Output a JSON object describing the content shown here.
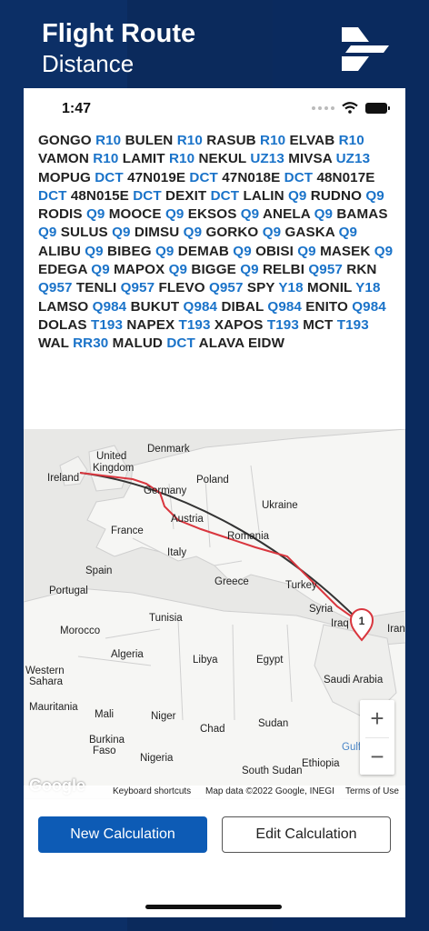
{
  "header": {
    "title_line1": "Flight Route",
    "title_line2": "Distance"
  },
  "status_bar": {
    "time": "1:47"
  },
  "route": [
    [
      "GONGO",
      "w"
    ],
    [
      "R10",
      "a"
    ],
    [
      "BULEN",
      "w"
    ],
    [
      "R10",
      "a"
    ],
    [
      "RASUB",
      "w"
    ],
    [
      "R10",
      "a"
    ],
    [
      "ELVAB",
      "w"
    ],
    [
      "R10",
      "a"
    ],
    [
      "VAMON",
      "w"
    ],
    [
      "R10",
      "a"
    ],
    [
      "LAMIT",
      "w"
    ],
    [
      "R10",
      "a"
    ],
    [
      "NEKUL",
      "w"
    ],
    [
      "UZ13",
      "a"
    ],
    [
      "MIVSA",
      "w"
    ],
    [
      "UZ13",
      "a"
    ],
    [
      "MOPUG",
      "w"
    ],
    [
      "DCT",
      "a"
    ],
    [
      "47N019E",
      "w"
    ],
    [
      "DCT",
      "a"
    ],
    [
      "47N018E",
      "w"
    ],
    [
      "DCT",
      "a"
    ],
    [
      "48N017E",
      "w"
    ],
    [
      "DCT",
      "a"
    ],
    [
      "48N015E",
      "w"
    ],
    [
      "DCT",
      "a"
    ],
    [
      "DEXIT",
      "w"
    ],
    [
      "DCT",
      "a"
    ],
    [
      "LALIN",
      "w"
    ],
    [
      "Q9",
      "a"
    ],
    [
      "RUDNO",
      "w"
    ],
    [
      "Q9",
      "a"
    ],
    [
      "RODIS",
      "w"
    ],
    [
      "Q9",
      "a"
    ],
    [
      "MOOCE",
      "w"
    ],
    [
      "Q9",
      "a"
    ],
    [
      "EKSOS",
      "w"
    ],
    [
      "Q9",
      "a"
    ],
    [
      "ANELA",
      "w"
    ],
    [
      "Q9",
      "a"
    ],
    [
      "BAMAS",
      "w"
    ],
    [
      "Q9",
      "a"
    ],
    [
      "SULUS",
      "w"
    ],
    [
      "Q9",
      "a"
    ],
    [
      "DIMSU",
      "w"
    ],
    [
      "Q9",
      "a"
    ],
    [
      "GORKO",
      "w"
    ],
    [
      "Q9",
      "a"
    ],
    [
      "GASKA",
      "w"
    ],
    [
      "Q9",
      "a"
    ],
    [
      "ALIBU",
      "w"
    ],
    [
      "Q9",
      "a"
    ],
    [
      "BIBEG",
      "w"
    ],
    [
      "Q9",
      "a"
    ],
    [
      "DEMAB",
      "w"
    ],
    [
      "Q9",
      "a"
    ],
    [
      "OBISI",
      "w"
    ],
    [
      "Q9",
      "a"
    ],
    [
      "MASEK",
      "w"
    ],
    [
      "Q9",
      "a"
    ],
    [
      "EDEGA",
      "w"
    ],
    [
      "Q9",
      "a"
    ],
    [
      "MAPOX",
      "w"
    ],
    [
      "Q9",
      "a"
    ],
    [
      "BIGGE",
      "w"
    ],
    [
      "Q9",
      "a"
    ],
    [
      "RELBI",
      "w"
    ],
    [
      "Q957",
      "a"
    ],
    [
      "RKN",
      "w"
    ],
    [
      "Q957",
      "a"
    ],
    [
      "TENLI",
      "w"
    ],
    [
      "Q957",
      "a"
    ],
    [
      "FLEVO",
      "w"
    ],
    [
      "Q957",
      "a"
    ],
    [
      "SPY",
      "w"
    ],
    [
      "Y18",
      "a"
    ],
    [
      "MONIL",
      "w"
    ],
    [
      "Y18",
      "a"
    ],
    [
      "LAMSO",
      "w"
    ],
    [
      "Q984",
      "a"
    ],
    [
      "BUKUT",
      "w"
    ],
    [
      "Q984",
      "a"
    ],
    [
      "DIBAL",
      "w"
    ],
    [
      "Q984",
      "a"
    ],
    [
      "ENITO",
      "w"
    ],
    [
      "Q984",
      "a"
    ],
    [
      "DOLAS",
      "w"
    ],
    [
      "T193",
      "a"
    ],
    [
      "NAPEX",
      "w"
    ],
    [
      "T193",
      "a"
    ],
    [
      "XAPOS",
      "w"
    ],
    [
      "T193",
      "a"
    ],
    [
      "MCT",
      "w"
    ],
    [
      "T193",
      "a"
    ],
    [
      "WAL",
      "w"
    ],
    [
      "RR30",
      "a"
    ],
    [
      "MALUD",
      "w"
    ],
    [
      "DCT",
      "a"
    ],
    [
      "ALAVA",
      "w"
    ],
    [
      "EIDW",
      "w"
    ]
  ],
  "map": {
    "labels": [
      {
        "name": "Ireland",
        "text": "Ireland"
      },
      {
        "name": "United",
        "text": "United"
      },
      {
        "name": "Kingdom",
        "text": "Kingdom"
      },
      {
        "name": "Denmark",
        "text": "Denmark"
      },
      {
        "name": "Poland",
        "text": "Poland"
      },
      {
        "name": "Germany",
        "text": "Germany"
      },
      {
        "name": "Ukraine",
        "text": "Ukraine"
      },
      {
        "name": "France",
        "text": "France"
      },
      {
        "name": "Austria",
        "text": "Austria"
      },
      {
        "name": "Romania",
        "text": "Romania"
      },
      {
        "name": "Italy",
        "text": "Italy"
      },
      {
        "name": "Spain",
        "text": "Spain"
      },
      {
        "name": "Portugal",
        "text": "Portugal"
      },
      {
        "name": "Greece",
        "text": "Greece"
      },
      {
        "name": "Turkey",
        "text": "Turkey"
      },
      {
        "name": "Syria",
        "text": "Syria"
      },
      {
        "name": "Iraq",
        "text": "Iraq"
      },
      {
        "name": "Iran",
        "text": "Iran"
      },
      {
        "name": "Tunisia",
        "text": "Tunisia"
      },
      {
        "name": "Morocco",
        "text": "Morocco"
      },
      {
        "name": "Algeria",
        "text": "Algeria"
      },
      {
        "name": "Libya",
        "text": "Libya"
      },
      {
        "name": "Egypt",
        "text": "Egypt"
      },
      {
        "name": "Western",
        "text": "Western"
      },
      {
        "name": "Sahara",
        "text": "Sahara"
      },
      {
        "name": "Saudi",
        "text": "Saudi Arabia"
      },
      {
        "name": "Mauritania",
        "text": "Mauritania"
      },
      {
        "name": "Mali",
        "text": "Mali"
      },
      {
        "name": "Niger",
        "text": "Niger"
      },
      {
        "name": "Chad",
        "text": "Chad"
      },
      {
        "name": "Sudan",
        "text": "Sudan"
      },
      {
        "name": "Burkina",
        "text": "Burkina"
      },
      {
        "name": "Faso",
        "text": "Faso"
      },
      {
        "name": "Nigeria",
        "text": "Nigeria"
      },
      {
        "name": "SouthSudan",
        "text": "South Sudan"
      },
      {
        "name": "Ethiopia",
        "text": "Ethiopia"
      },
      {
        "name": "Yemen",
        "text": "Ye"
      },
      {
        "name": "Gulf",
        "text": "Gulf"
      }
    ],
    "marker_label": "1",
    "attribution_keyboard": "Keyboard shortcuts",
    "attribution_data": "Map data ©2022 Google, INEGI",
    "attribution_terms": "Terms of Use",
    "google": "Google",
    "zoom_in": "+",
    "zoom_out": "−",
    "route_colors": {
      "great_circle": "#333333",
      "flight_route": "#d9363e"
    }
  },
  "buttons": {
    "new_calculation": "New Calculation",
    "edit_calculation": "Edit Calculation"
  },
  "colors": {
    "brand_dark": "#0b2a5c",
    "primary": "#0d5bb5",
    "airway": "#1a73c9"
  }
}
